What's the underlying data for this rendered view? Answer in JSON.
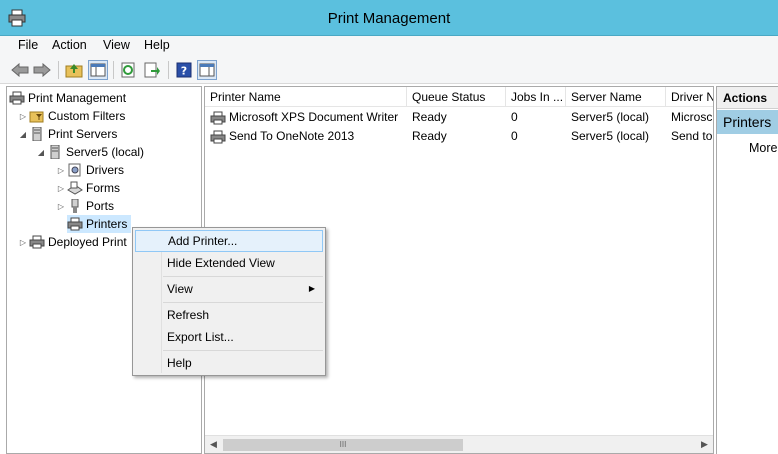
{
  "window": {
    "title": "Print Management"
  },
  "menubar": {
    "items": [
      "File",
      "Action",
      "View",
      "Help"
    ]
  },
  "toolbar": {
    "icons": [
      "back-arrow-icon",
      "forward-arrow-icon",
      "up-folder-icon",
      "show-hide-tree-icon",
      "refresh-icon",
      "export-list-icon",
      "help-icon",
      "show-hide-action-pane-icon"
    ]
  },
  "tree": {
    "items": [
      {
        "label": "Print Management",
        "icon": "print-management-icon"
      },
      {
        "label": "Custom Filters",
        "icon": "filter-folder-icon"
      },
      {
        "label": "Print Servers",
        "icon": "server-icon"
      },
      {
        "label": "Server5 (local)",
        "icon": "server-icon"
      },
      {
        "label": "Drivers",
        "icon": "drivers-icon"
      },
      {
        "label": "Forms",
        "icon": "forms-icon"
      },
      {
        "label": "Ports",
        "icon": "ports-icon"
      },
      {
        "label": "Printers",
        "icon": "printer-icon"
      },
      {
        "label": "Deployed Print",
        "icon": "printer-icon"
      }
    ]
  },
  "list": {
    "columns": [
      "Printer Name",
      "Queue Status",
      "Jobs In ...",
      "Server Name",
      "Driver N"
    ],
    "rows": [
      [
        "Microsoft XPS Document Writer",
        "Ready",
        "0",
        "Server5 (local)",
        "Microsc"
      ],
      [
        "Send To OneNote 2013",
        "Ready",
        "0",
        "Server5 (local)",
        "Send to"
      ]
    ],
    "scroll_thumb_glyph": "III"
  },
  "actions": {
    "header": "Actions",
    "section": "Printers",
    "more": "More"
  },
  "context_menu": {
    "items": [
      {
        "label": "Add Printer..."
      },
      {
        "label": "Hide Extended View"
      },
      {
        "label": "View"
      },
      {
        "label": "Refresh"
      },
      {
        "label": "Export List..."
      },
      {
        "label": "Help"
      }
    ]
  }
}
